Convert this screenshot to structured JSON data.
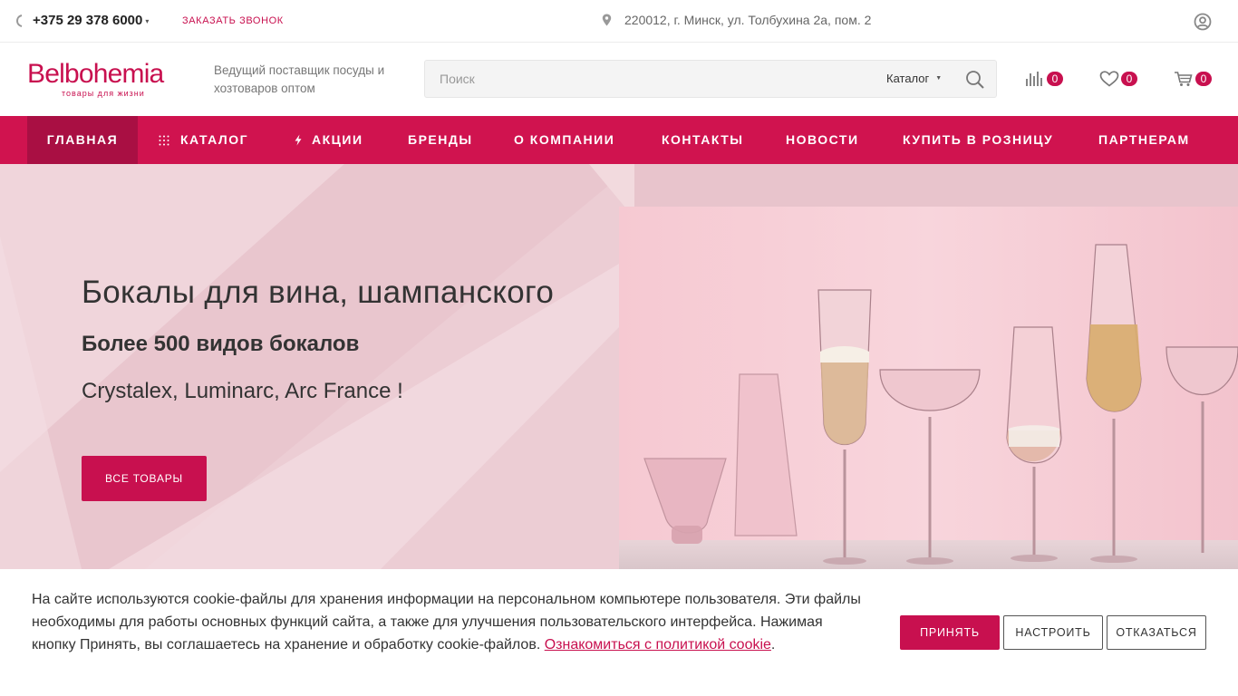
{
  "topbar": {
    "phone": "+375 29 378 6000",
    "callback": "Заказать звонок",
    "address": "220012, г. Минск, ул. Толбухина 2а, пом. 2"
  },
  "header": {
    "logo_name": "Belbohemia",
    "logo_sub": "товары для жизни",
    "tagline": "Ведущий поставщик посуды и хозтоваров оптом",
    "search_placeholder": "Поиск",
    "search_category": "Каталог",
    "compare_count": "0",
    "favorites_count": "0",
    "cart_count": "0"
  },
  "nav": {
    "items": [
      {
        "label": "Главная"
      },
      {
        "label": "Каталог"
      },
      {
        "label": "Акции"
      },
      {
        "label": "Бренды"
      },
      {
        "label": "О компании"
      },
      {
        "label": "Контакты"
      },
      {
        "label": "Новости"
      },
      {
        "label": "Купить в розницу"
      },
      {
        "label": "Партнерам"
      }
    ]
  },
  "banner": {
    "title": "Бокалы для вина, шампанского",
    "subtitle": "Более 500 видов бокалов",
    "brands": "Crystalex, Luminarc, Arc France !",
    "button": "Все товары"
  },
  "cookie": {
    "text": "На сайте используются cookie-файлы для хранения информации на персональном компьютере пользователя. Эти файлы необходимы для работы основных функций сайта, а также для улучшения пользовательского интерфейса. Нажимая кнопку Принять, вы соглашаетесь на хранение и обработку cookie-файлов. ",
    "link": "Ознакомиться с политикой cookie",
    "tail": ".",
    "accept": "Принять",
    "configure": "Настроить",
    "decline": "Отказаться"
  },
  "colors": {
    "accent": "#c8104f",
    "nav_bg": "#d0134f",
    "nav_active": "#a90f43",
    "banner_bg": "#eccdd4"
  },
  "icons": [
    "phone-icon",
    "location-pin-icon",
    "user-icon",
    "search-icon",
    "compare-icon",
    "heart-icon",
    "cart-icon",
    "grid-icon",
    "lightning-icon"
  ]
}
